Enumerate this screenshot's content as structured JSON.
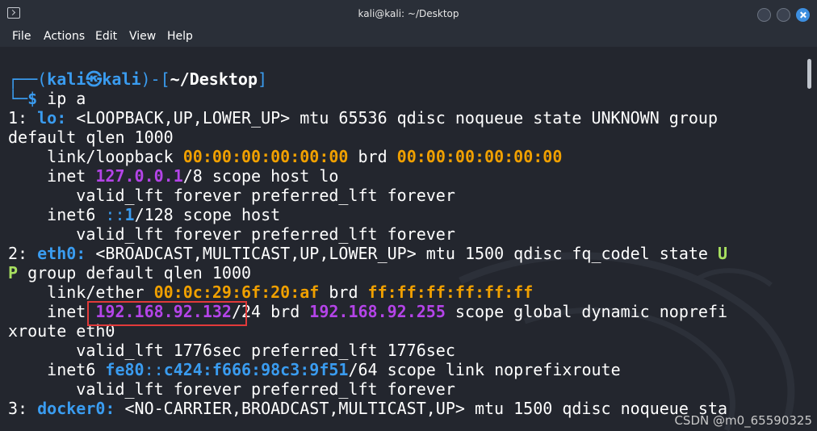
{
  "window": {
    "title": "kali@kali: ~/Desktop"
  },
  "menu": [
    "File",
    "Actions",
    "Edit",
    "View",
    "Help"
  ],
  "prompt": {
    "box_top": "┌──(",
    "user": "kali",
    "at": "㉿",
    "host": "kali",
    "sep": ")-[",
    "path": "~/Desktop",
    "close": "]",
    "box_bottom": "└─",
    "dollar": "$",
    "command": "ip a"
  },
  "output": {
    "l1_num": "1: ",
    "l1_if": "lo:",
    "l1_rest": " <LOOPBACK,UP,LOWER_UP> mtu 65536 qdisc noqueue state UNKNOWN group",
    "l2": "default qlen 1000",
    "l3_pre": "    link/loopback ",
    "l3_mac": "00:00:00:00:00:00",
    "l3_mid": " brd ",
    "l3_brd": "00:00:00:00:00:00",
    "l4_pre": "    inet ",
    "l4_ip": "127.0.0.1",
    "l4_rest": "/8 scope host lo",
    "l5": "       valid_lft forever preferred_lft forever",
    "l6_pre": "    inet6 ",
    "l6_a": "::",
    "l6_b": "1",
    "l6_rest": "/128 scope host",
    "l7": "       valid_lft forever preferred_lft forever",
    "l8_num": "2: ",
    "l8_if": "eth0:",
    "l8_rest": " <BROADCAST,MULTICAST,UP,LOWER_UP> mtu 1500 qdisc fq_codel state ",
    "l8_state": "U",
    "l9_state": "P",
    "l9_rest": " group default qlen 1000",
    "l10_pre": "    link/ether ",
    "l10_mac": "00:0c:29:6f:20:af",
    "l10_mid": " brd ",
    "l10_brd": "ff:ff:ff:ff:ff:ff",
    "l11_pre": "    inet ",
    "l11_ip": "192.168.92.132",
    "l11_mid": "/24 brd ",
    "l11_brd": "192.168.92.255",
    "l11_rest": " scope global dynamic noprefi",
    "l12": "xroute eth0",
    "l13": "       valid_lft 1776sec preferred_lft 1776sec",
    "l14_pre": "    inet6 ",
    "l14_a": "fe80",
    "l14_b": "::",
    "l14_c": "c424:f666:98c3:9f51",
    "l14_rest": "/64 scope link noprefixroute",
    "l15": "       valid_lft forever preferred_lft forever",
    "l16_num": "3: ",
    "l16_if": "docker0:",
    "l16_rest": " <NO-CARRIER,BROADCAST,MULTICAST,UP> mtu 1500 qdisc noqueue sta"
  },
  "watermark": "CSDN @m0_65590325",
  "colors": {
    "prompt_blue": "#3a9cf0",
    "mac_orange": "#f0a000",
    "ip_purple": "#b444e8",
    "state_green": "#a8e060",
    "highlight_red": "#e23a3a"
  }
}
